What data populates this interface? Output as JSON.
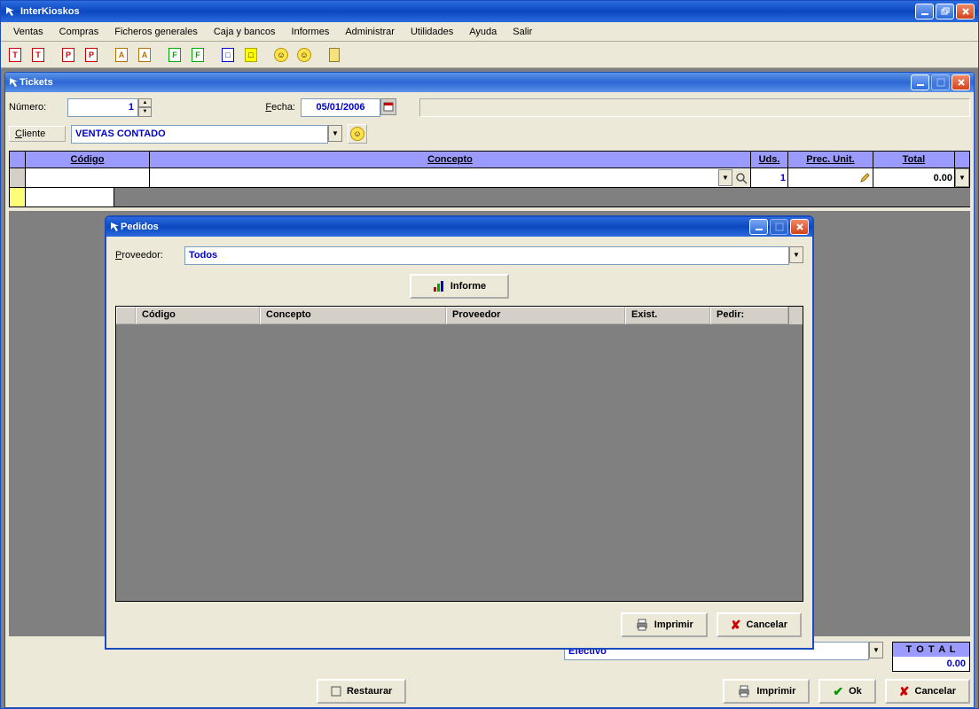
{
  "app": {
    "title": "InterKioskos"
  },
  "menu": {
    "ventas": "Ventas",
    "compras": "Compras",
    "ficheros": "Ficheros generales",
    "caja": "Caja y bancos",
    "informes": "Informes",
    "administrar": "Administrar",
    "utilidades": "Utilidades",
    "ayuda": "Ayuda",
    "salir": "Salir"
  },
  "tickets": {
    "title": "Tickets",
    "numero_label": "Número:",
    "numero_value": "1",
    "fecha_label": "Fecha:",
    "fecha_value": "05/01/2006",
    "cliente_label": "Cliente",
    "cliente_value": "VENTAS CONTADO",
    "grid": {
      "codigo": "Código",
      "concepto": "Concepto",
      "uds": "Uds.",
      "prec_unit": "Prec. Unit.",
      "total": "Total"
    },
    "row1": {
      "uds": "1",
      "total": "0.00"
    },
    "pay_method": "Efectivo",
    "total_label": "T O T A L",
    "total_value": "0.00",
    "btn_restaurar": "Restaurar",
    "btn_imprimir": "Imprimir",
    "btn_ok": "Ok",
    "btn_cancelar": "Cancelar"
  },
  "pedidos": {
    "title": "Pedidos",
    "proveedor_label": "Proveedor:",
    "proveedor_value": "Todos",
    "btn_informe": "Informe",
    "grid": {
      "codigo": "Código",
      "concepto": "Concepto",
      "proveedor": "Proveedor",
      "exist": "Exist.",
      "pedir": "Pedir:"
    },
    "btn_imprimir": "Imprimir",
    "btn_cancelar": "Cancelar"
  }
}
